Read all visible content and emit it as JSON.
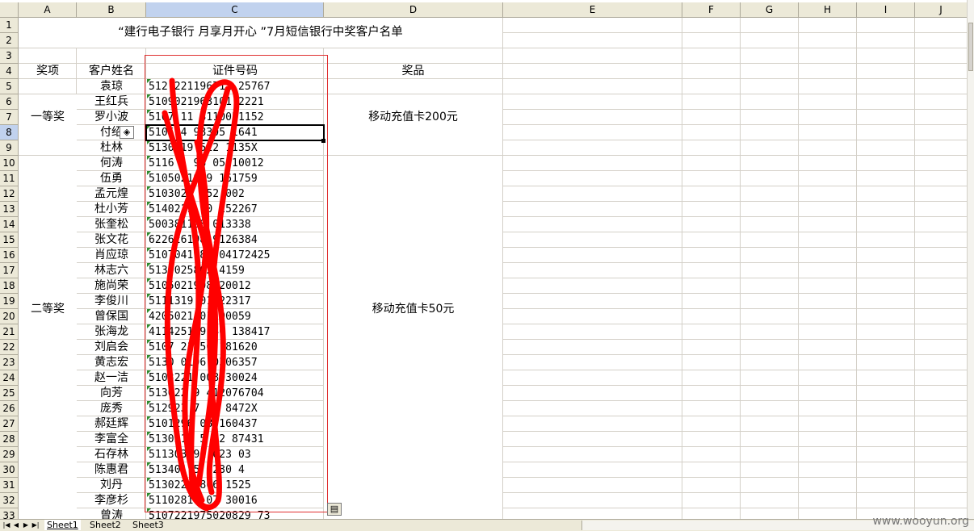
{
  "columns": [
    "A",
    "B",
    "C",
    "D",
    "E",
    "F",
    "G",
    "H",
    "I",
    "J"
  ],
  "selected_column": "C",
  "rows": [
    "1",
    "2",
    "3",
    "4",
    "5",
    "6",
    "7",
    "8",
    "9",
    "10",
    "11",
    "12",
    "13",
    "14",
    "15",
    "16",
    "17",
    "18",
    "19",
    "20",
    "21",
    "22",
    "23",
    "24",
    "25",
    "26",
    "27",
    "28",
    "29",
    "30",
    "31",
    "32",
    "33"
  ],
  "selected_row": "8",
  "title": "“建行电子银行  月享月开心 ”7月短信银行中奖客户名单",
  "headers": {
    "prize_level": "奖项",
    "customer_name": "客户姓名",
    "id_number": "证件号码",
    "prize": "奖品"
  },
  "first_prize": {
    "level": "一等奖",
    "prize": "移动充值卡200元"
  },
  "second_prize": {
    "level": "二等奖",
    "prize": "移动充值卡50元"
  },
  "winners": [
    {
      "name": "袁琼",
      "id": "512 221196711 25767"
    },
    {
      "name": "王红兵",
      "id": "5109021963101 2221"
    },
    {
      "name": "罗小波",
      "id": "5107 11 8110051152"
    },
    {
      "name": "付绍",
      "id": "5105 4 98305 1641"
    },
    {
      "name": "杜林",
      "id": "5130219 512 1135X"
    },
    {
      "name": "何涛",
      "id": "5116 1 98 05 10012"
    },
    {
      "name": "伍勇",
      "id": "5105021959 161759"
    },
    {
      "name": "孟元煌",
      "id": "5103026 052 002"
    },
    {
      "name": "杜小芳",
      "id": "5140219 70 252267"
    },
    {
      "name": "张奎松",
      "id": "500381198 013338"
    },
    {
      "name": "张文花",
      "id": "622626198 9126384"
    },
    {
      "name": "肖应琼",
      "id": "5107041980 04172425"
    },
    {
      "name": "林志六",
      "id": "5130025802 4159"
    },
    {
      "name": "施尚荣",
      "id": "5105021908020012"
    },
    {
      "name": "李俊川",
      "id": "5111319 01022317"
    },
    {
      "name": "曾保国",
      "id": "4205021 01100059"
    },
    {
      "name": "张海龙",
      "id": "4114251 9 46 138417"
    },
    {
      "name": "刘启会",
      "id": "5107 21 50 181620"
    },
    {
      "name": "黄志宏",
      "id": "5130 0196 0306357"
    },
    {
      "name": "赵一洁",
      "id": "5103221 008030024"
    },
    {
      "name": "向芳",
      "id": "513022 9 412076704"
    },
    {
      "name": "庞秀",
      "id": "512923 7 11 8472X"
    },
    {
      "name": "郝廷辉",
      "id": "5101296 08 160437"
    },
    {
      "name": "李富全",
      "id": "5130219 5 02 87431"
    },
    {
      "name": "石存林",
      "id": "511303 91 023 03"
    },
    {
      "name": "陈惠君",
      "id": "513401 5 0230 4"
    },
    {
      "name": "刘丹",
      "id": "513022 9806 1525"
    },
    {
      "name": "李彦杉",
      "id": "51102819 07 30016"
    },
    {
      "name": "曾涛",
      "id": "5107221975020829 73"
    }
  ],
  "sheet_tabs": [
    "Sheet1",
    "Sheet2",
    "Sheet3"
  ],
  "active_tab": "Sheet1",
  "watermark": "www.wooyun.org",
  "colors": {
    "header_bg": "#ece9d8",
    "selected_header_bg": "#c1d2ee",
    "gridline": "#d4d0c8",
    "scribble_red": "#ff0000",
    "id_marker_green": "#2d8a2d"
  }
}
